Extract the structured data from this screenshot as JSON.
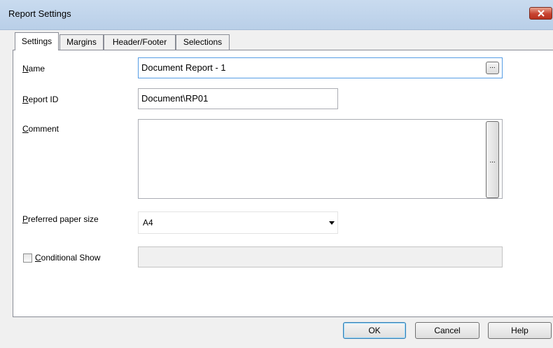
{
  "window": {
    "title": "Report Settings",
    "close_icon": "close-icon"
  },
  "tabs": [
    {
      "label": "Settings",
      "active": true
    },
    {
      "label": "Margins",
      "active": false
    },
    {
      "label": "Header/Footer",
      "active": false
    },
    {
      "label": "Selections",
      "active": false
    }
  ],
  "form": {
    "name": {
      "label_u": "N",
      "label_rest": "ame",
      "value": "Document Report - 1",
      "button": "..."
    },
    "report_id": {
      "label_u": "R",
      "label_rest": "eport ID",
      "value": "Document\\RP01"
    },
    "comment": {
      "label_u": "C",
      "label_rest": "omment",
      "value": "",
      "button": "..."
    },
    "paper_size": {
      "label_u": "P",
      "label_rest": "referred paper size",
      "value": "A4"
    },
    "conditional_show": {
      "label_u": "C",
      "label_rest": "onditional Show",
      "checked": false,
      "value": ""
    }
  },
  "buttons": {
    "ok": "OK",
    "cancel": "Cancel",
    "help": "Help"
  }
}
